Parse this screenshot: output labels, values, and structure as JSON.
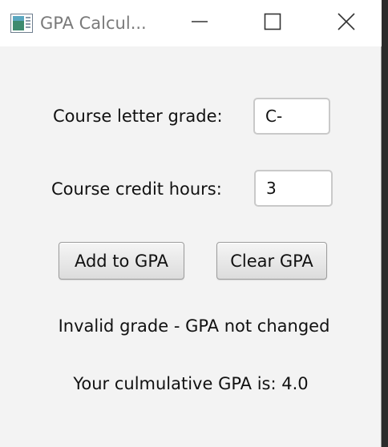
{
  "window": {
    "title": "GPA Calcul..."
  },
  "titlebar": {
    "icons": {
      "app": "app-icon",
      "minimize": "minimize-icon",
      "maximize": "maximize-icon",
      "close": "close-icon"
    }
  },
  "form": {
    "grade_label": "Course letter grade:",
    "grade_value": "C-",
    "credit_label": "Course credit hours:",
    "credit_value": "3"
  },
  "buttons": {
    "add_label": "Add to GPA",
    "clear_label": "Clear GPA"
  },
  "status": {
    "message": "Invalid grade - GPA not changed",
    "gpa_text": "Your culmulative GPA is: 4.0"
  },
  "colors": {
    "window_bg": "#f3f3f3",
    "titlebar_bg": "#ffffff",
    "text": "#111111"
  }
}
